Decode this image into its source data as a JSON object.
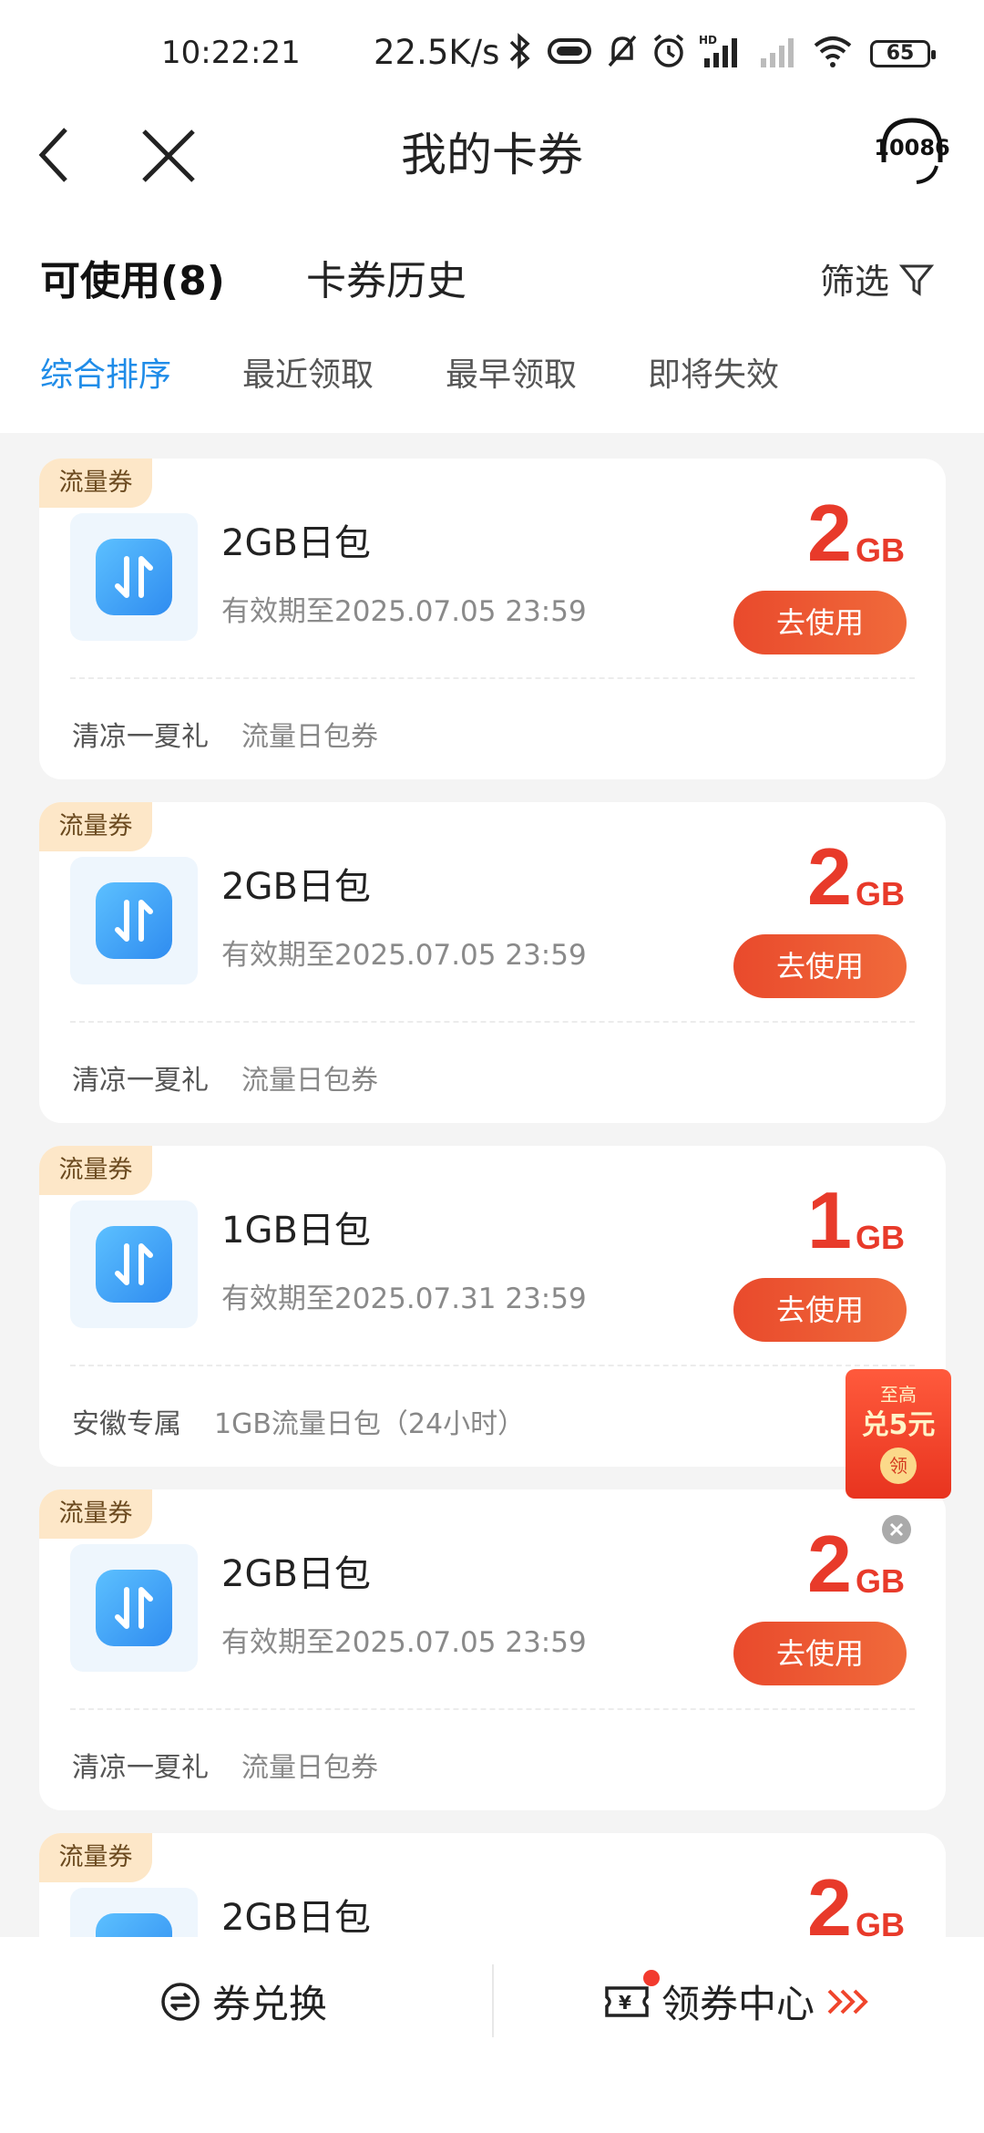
{
  "status_bar": {
    "time": "10:22:21",
    "net_speed": "22.5K/s",
    "battery": "65"
  },
  "nav": {
    "title": "我的卡券",
    "service_number": "10086"
  },
  "tabs": {
    "available": "可使用(8)",
    "history": "卡券历史",
    "filter": "筛选"
  },
  "sort": {
    "items": [
      "综合排序",
      "最近领取",
      "最早领取",
      "即将失效"
    ],
    "active_index": 0
  },
  "cards": [
    {
      "tag": "流量券",
      "title": "2GB日包",
      "validity": "有效期至2025.07.05 23:59",
      "amount": "2",
      "unit": "GB",
      "button": "去使用",
      "footer_main": "清凉一夏礼",
      "footer_sub": "流量日包券"
    },
    {
      "tag": "流量券",
      "title": "2GB日包",
      "validity": "有效期至2025.07.05 23:59",
      "amount": "2",
      "unit": "GB",
      "button": "去使用",
      "footer_main": "清凉一夏礼",
      "footer_sub": "流量日包券"
    },
    {
      "tag": "流量券",
      "title": "1GB日包",
      "validity": "有效期至2025.07.31 23:59",
      "amount": "1",
      "unit": "GB",
      "button": "去使用",
      "footer_main": "安徽专属",
      "footer_sub": "1GB流量日包（24小时）"
    },
    {
      "tag": "流量券",
      "title": "2GB日包",
      "validity": "有效期至2025.07.05 23:59",
      "amount": "2",
      "unit": "GB",
      "button": "去使用",
      "footer_main": "清凉一夏礼",
      "footer_sub": "流量日包券"
    },
    {
      "tag": "流量券",
      "title": "2GB日包",
      "validity": "",
      "amount": "2",
      "unit": "GB",
      "button": "",
      "footer_main": "",
      "footer_sub": ""
    }
  ],
  "promo": {
    "top": "至高",
    "main": "兑5元",
    "badge": "领"
  },
  "bottom_bar": {
    "exchange": "券兑换",
    "center": "领券中心"
  },
  "colors": {
    "accent_blue": "#1f8ce8",
    "price_red": "#e83a2a",
    "button_red": "#ec5131",
    "tag_bg": "#fde7c8"
  }
}
